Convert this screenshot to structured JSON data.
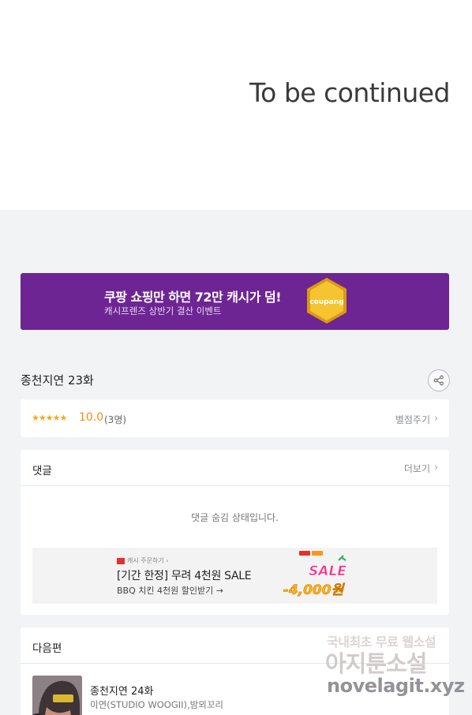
{
  "hero": {
    "text": "To be continued"
  },
  "banner": {
    "title": "쿠팡 쇼핑만 하면 72만 캐시가 덤!",
    "subtitle": "캐시프렌즈 상반기 결산 이벤트",
    "coin_text": "coupang",
    "bg_color": "#6e2594",
    "coin_color": "#f5c430"
  },
  "episode": {
    "title": "종천지연 23화"
  },
  "rating": {
    "stars": "★★★★★",
    "score": "10.0",
    "count": "(3명)",
    "rate_label": "별점주기"
  },
  "comments": {
    "heading": "댓글",
    "more_label": "더보기",
    "hidden_message": "댓글 숨김 상태입니다."
  },
  "ad": {
    "tag": "캐시 주문하기 ›",
    "title": "[기간 한정] 무려 4천원 SALE",
    "subtitle": "BBQ 치킨 4천원 할인받기 →",
    "sale_word": "SALE",
    "amount": "-4,000원"
  },
  "next": {
    "heading": "다음편",
    "title": "종천지연 24화",
    "author": "이연(STUDIO WOOGII),밤뫼꼬리"
  },
  "watermark": {
    "line1": "국내최초 무료 웹소설",
    "line2": "아지툰소설",
    "line3": "novelagit.xyz"
  }
}
